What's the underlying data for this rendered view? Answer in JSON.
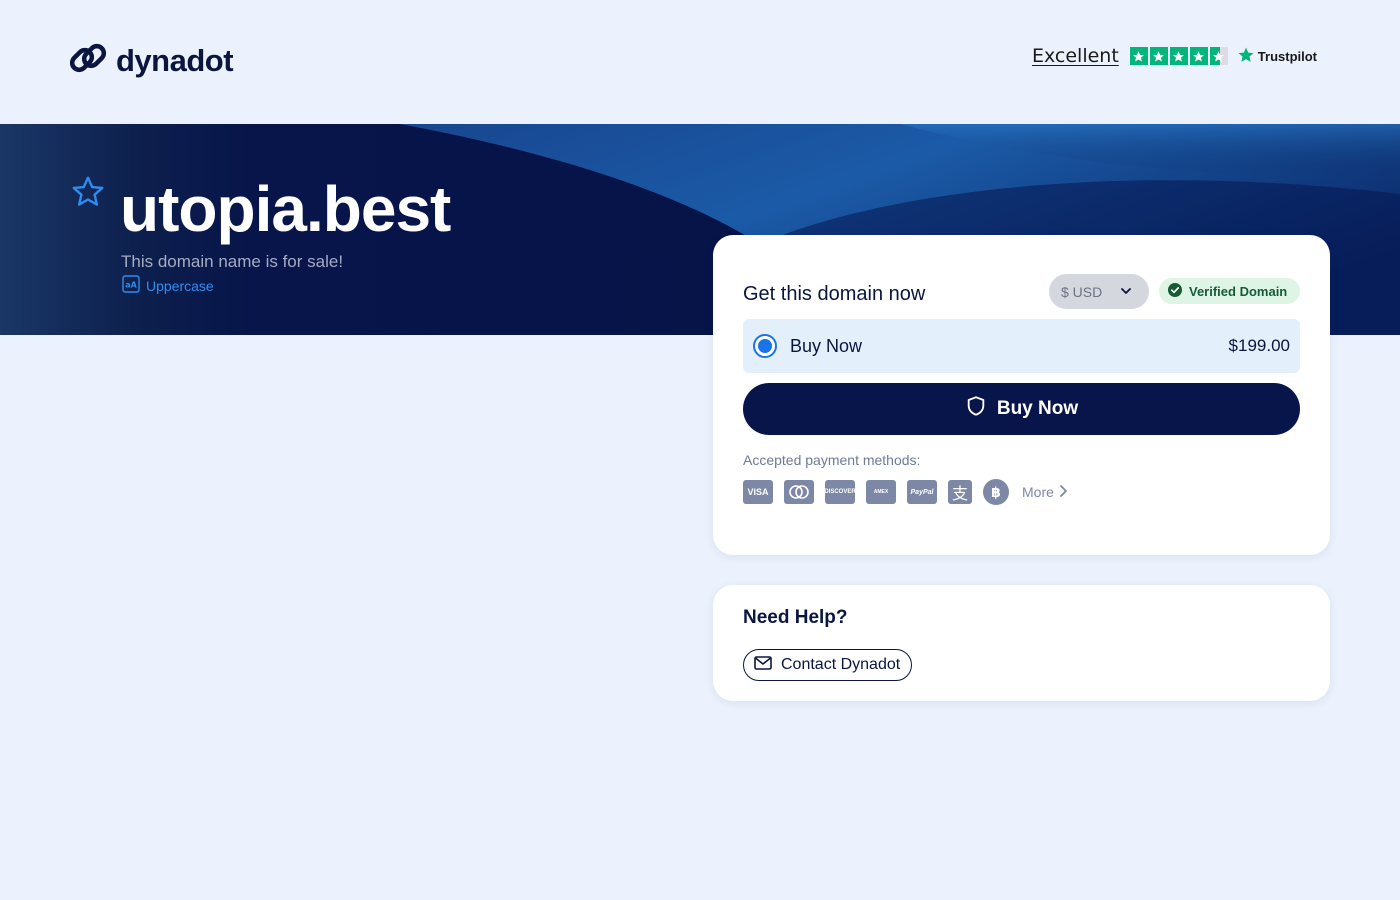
{
  "header": {
    "logo_text": "dynadot",
    "trustpilot": {
      "rating_label": "Excellent",
      "brand": "Trustpilot",
      "star_rating": 4.5,
      "star_color": "#00b67a"
    }
  },
  "hero": {
    "domain": "utopia.best",
    "subtitle": "This domain name is for sale!",
    "uppercase_label": "Uppercase"
  },
  "purchase": {
    "title": "Get this domain now",
    "currency": "$ USD",
    "verified_label": "Verified Domain",
    "option_label": "Buy Now",
    "option_price": "$199.00",
    "button_label": "Buy Now",
    "payment_label": "Accepted payment methods:",
    "payment_methods": [
      "visa-icon",
      "mastercard-icon",
      "discover-icon",
      "amex-icon",
      "paypal-icon",
      "alipay-icon",
      "bitcoin-icon"
    ],
    "more_label": "More"
  },
  "help": {
    "title": "Need Help?",
    "contact_label": "Contact Dynadot"
  },
  "colors": {
    "background": "#ebf2fd",
    "navy": "#07154a",
    "accent_blue": "#1a73e8"
  }
}
